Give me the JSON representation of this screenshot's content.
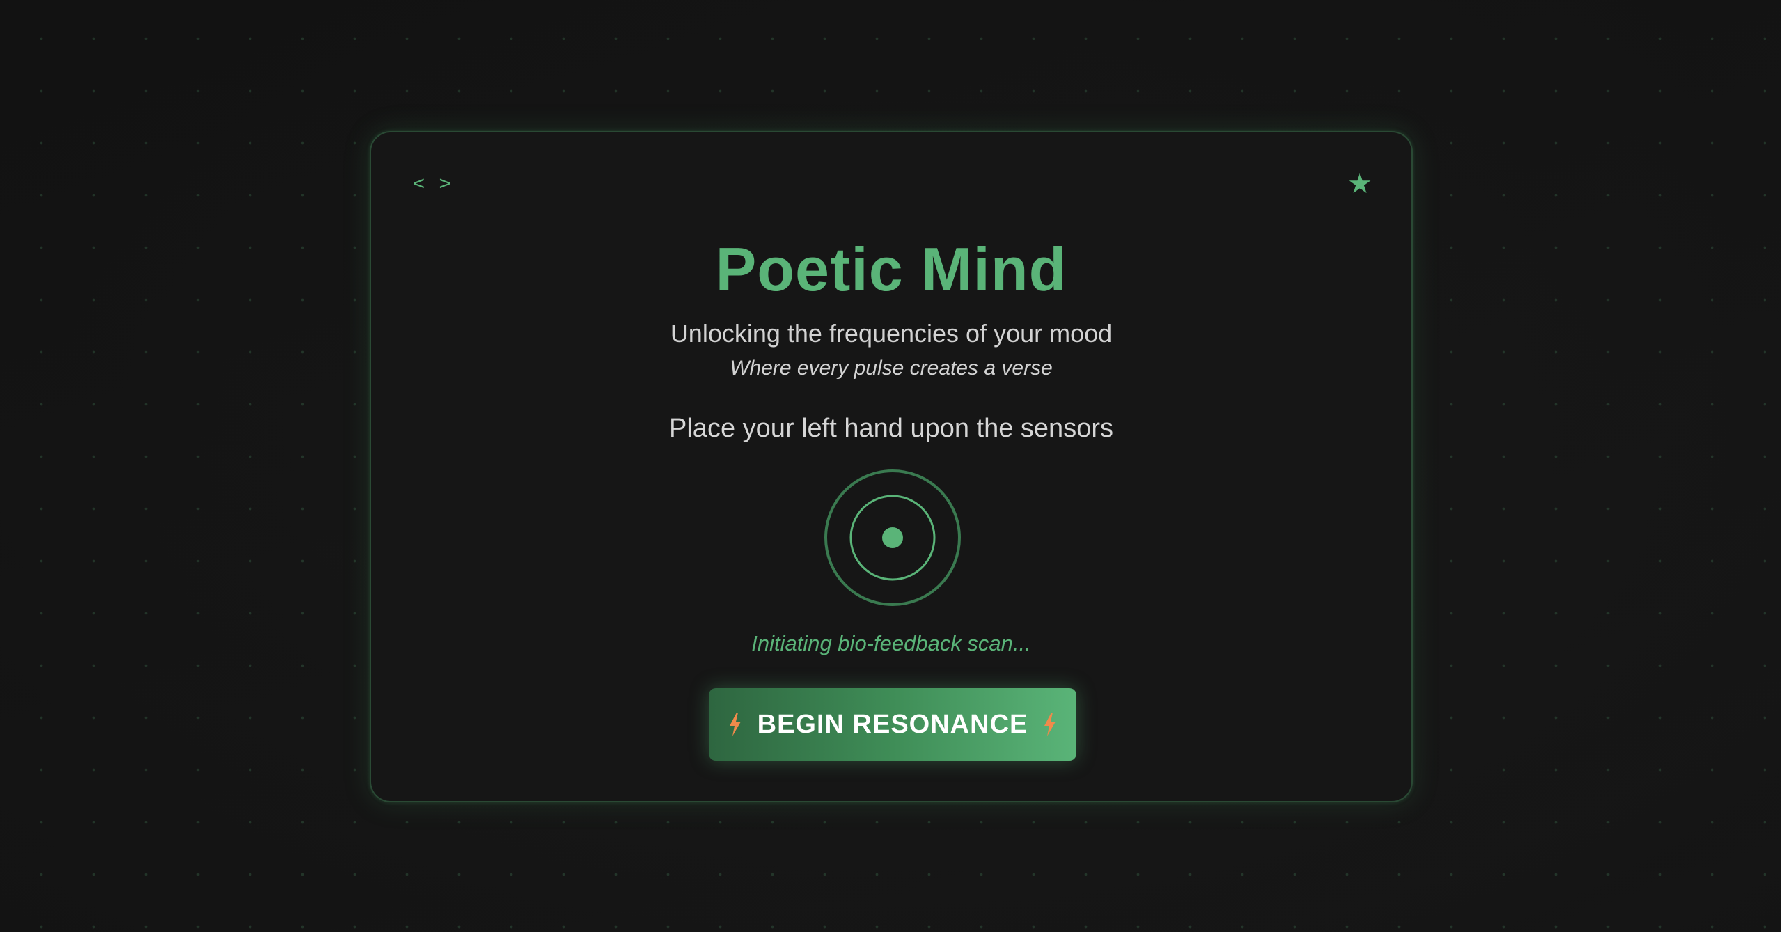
{
  "card": {
    "code_icon_text": "< >",
    "star_icon_text": "★",
    "title": "Poetic Mind",
    "subtitle": "Unlocking the frequencies of your mood",
    "tagline": "Where every pulse creates a verse",
    "instruction": "Place your left hand upon the sensors",
    "status": "Initiating bio-feedback scan...",
    "button_label": "BEGIN RESONANCE"
  },
  "icons": {
    "code": "code-brackets-icon",
    "star": "star-icon",
    "sensor": "sensor-pulse-icon",
    "bolt": "lightning-bolt-icon"
  },
  "colors": {
    "accent": "#5ab478",
    "background": "#141414",
    "card": "#161616",
    "text": "#d2d2d2",
    "bolt": "#f08a4b"
  }
}
